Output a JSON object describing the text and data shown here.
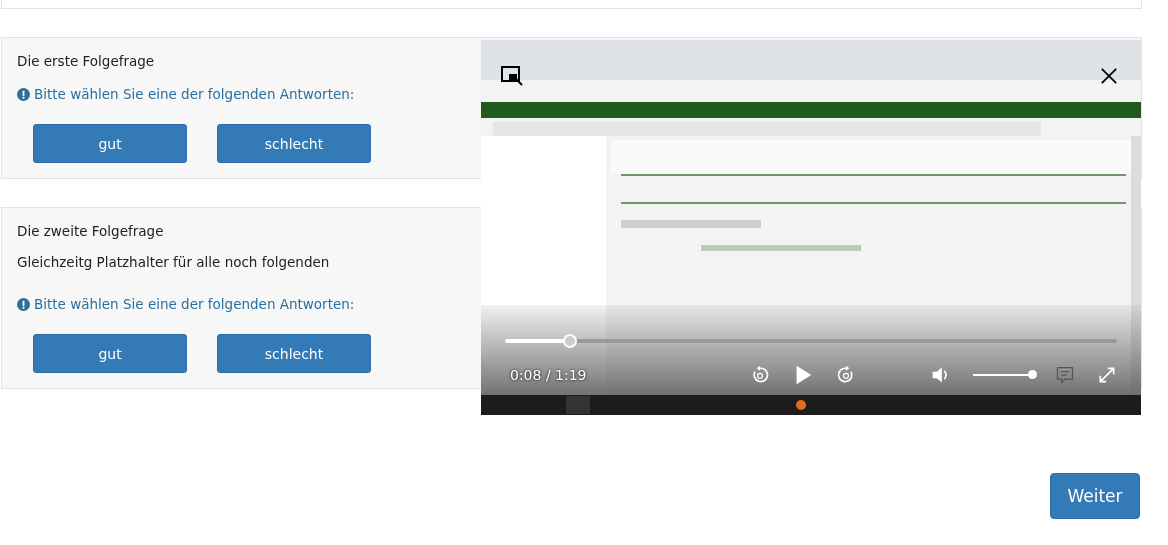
{
  "questions": [
    {
      "title": "Die erste Folgefrage",
      "hint": "Bitte wählen Sie eine der folgenden Antworten:",
      "answers": [
        "gut",
        "schlecht"
      ]
    },
    {
      "title": "Die zweite Folgefrage",
      "subtitle": "Gleichzeitg Platzhalter für alle noch folgenden",
      "hint": "Bitte wählen Sie eine der folgenden Antworten:",
      "answers": [
        "gut",
        "schlecht"
      ]
    }
  ],
  "video": {
    "kind": "picture",
    "time": "0:08 / 1:19",
    "progress": {
      "level": 0.106
    },
    "volume": {
      "level": 1.0
    }
  },
  "next_button": "Weiter"
}
